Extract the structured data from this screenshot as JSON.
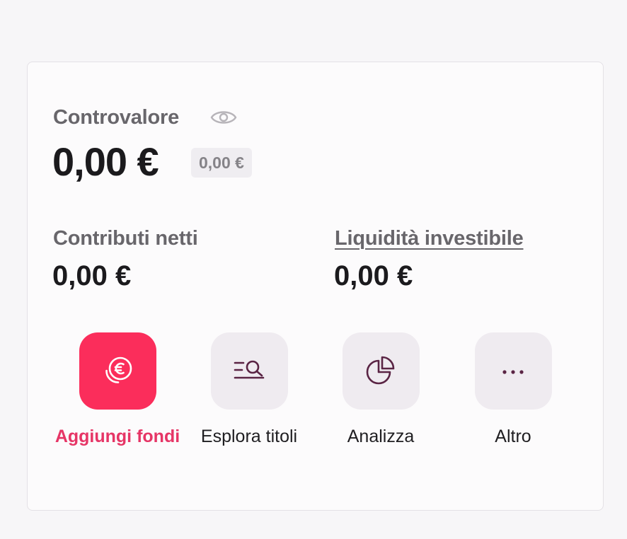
{
  "portfolio": {
    "controvalore_label": "Controvalore",
    "controvalore_value": "0,00 €",
    "controvalore_badge": "0,00 €",
    "contributi_label": "Contributi netti",
    "contributi_value": "0,00 €",
    "liquidita_label": "Liquidità investibile",
    "liquidita_value": "0,00 €"
  },
  "actions": [
    {
      "label": "Aggiungi fondi",
      "icon": "euro-coins-icon"
    },
    {
      "label": "Esplora titoli",
      "icon": "search-list-icon"
    },
    {
      "label": "Analizza",
      "icon": "pie-chart-icon"
    },
    {
      "label": "Altro",
      "icon": "more-dots-icon"
    }
  ],
  "colors": {
    "accent": "#fb2d5b",
    "accent_text": "#e63566",
    "icon_stroke": "#5a2444",
    "tile_bg": "#efebf0"
  }
}
